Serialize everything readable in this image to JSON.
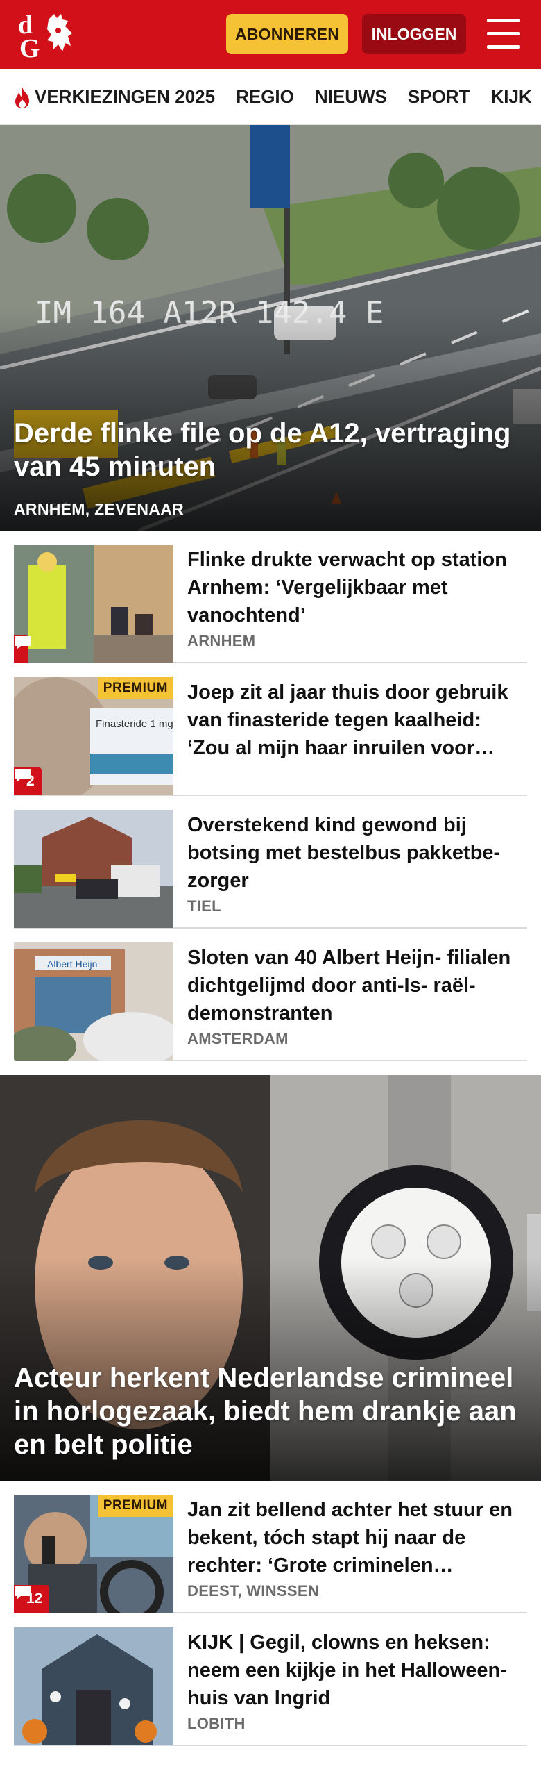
{
  "header": {
    "logo_alt": "dG",
    "subscribe_label": "ABONNEREN",
    "login_label": "INLOGGEN",
    "brand_color": "#d1101a",
    "accent_color": "#f6c235"
  },
  "nav": {
    "items": [
      {
        "label": "VERKIEZINGEN 2025",
        "icon": "flame-icon"
      },
      {
        "label": "REGIO"
      },
      {
        "label": "NIEUWS"
      },
      {
        "label": "SPORT"
      },
      {
        "label": "KIJK"
      }
    ]
  },
  "hero1": {
    "title": "Derde flinke file op de A12, vertraging van 45 minuten",
    "location": "ARNHEM, ZEVENAAR",
    "overlay_text": "IM 164 A12R 142.4 E"
  },
  "list1": [
    {
      "title": "Flinke drukte verwacht op station Arnhem: ‘Vergelijkbaar met vanochtend’",
      "location": "ARNHEM",
      "premium": false,
      "comments": ""
    },
    {
      "title": "Joep zit al jaar thuis door gebruik van finasteride tegen kaalheid: ‘Zou al mijn haar inruilen voor…",
      "location": "",
      "premium": true,
      "premium_label": "PREMIUM",
      "comments": "2",
      "image_text": "Finasteride 1 mg"
    },
    {
      "title": "Overstekend kind gewond bij botsing met bestelbus pakketbe- zorger",
      "location": "TIEL",
      "premium": false,
      "comments": ""
    },
    {
      "title": "Sloten van 40 Albert Heijn- filialen dichtgelijmd door anti-Is- raël-demonstranten",
      "location": "AMSTERDAM",
      "premium": false,
      "comments": "",
      "image_text": "Albert Heijn"
    }
  ],
  "hero2": {
    "title": "Acteur herkent Nederlandse crimineel in horlogezaak, biedt hem drankje aan en belt politie",
    "location": ""
  },
  "list2": [
    {
      "title": "Jan zit bellend achter het stuur en bekent, tóch stapt hij naar de rechter: ‘Grote criminelen…",
      "location": "DEEST, WINSSEN",
      "premium": true,
      "premium_label": "PREMIUM",
      "comments": "12"
    },
    {
      "title": "KIJK | Gegil, clowns en heksen: neem een kijkje in het Halloween- huis van Ingrid",
      "location": "LOBITH",
      "premium": false,
      "comments": ""
    }
  ]
}
